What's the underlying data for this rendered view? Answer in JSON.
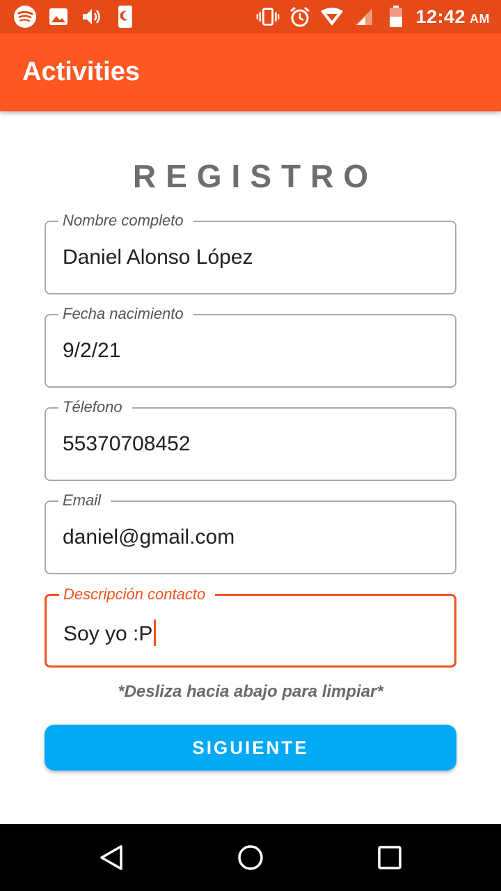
{
  "status_bar": {
    "time": "12:42",
    "ampm": "AM",
    "left_icons": [
      "spotify-icon",
      "image-icon",
      "volume-icon",
      "night-mode-icon"
    ],
    "right_icons": [
      "vibrate-icon",
      "alarm-icon",
      "wifi-icon",
      "signal-icon",
      "battery-icon"
    ]
  },
  "app_bar": {
    "title": "Activities"
  },
  "form": {
    "title": "REGISTRO",
    "fields": [
      {
        "label": "Nombre completo",
        "value": "Daniel Alonso López"
      },
      {
        "label": "Fecha nacimiento",
        "value": "9/2/21"
      },
      {
        "label": "Télefono",
        "value": "55370708452"
      },
      {
        "label": "Email",
        "value": "daniel@gmail.com"
      },
      {
        "label": "Descripción contacto",
        "value": "Soy yo :P",
        "focused": true
      }
    ],
    "hint": "*Desliza hacia abajo para limpiar*",
    "next_button": "SIGUIENTE"
  },
  "colors": {
    "status_bar": "#e64a19",
    "app_bar": "#ff5722",
    "accent": "#f4511e",
    "button": "#03a9f4"
  },
  "nav_bar": {
    "buttons": [
      "back-icon",
      "home-icon",
      "recents-icon"
    ]
  }
}
